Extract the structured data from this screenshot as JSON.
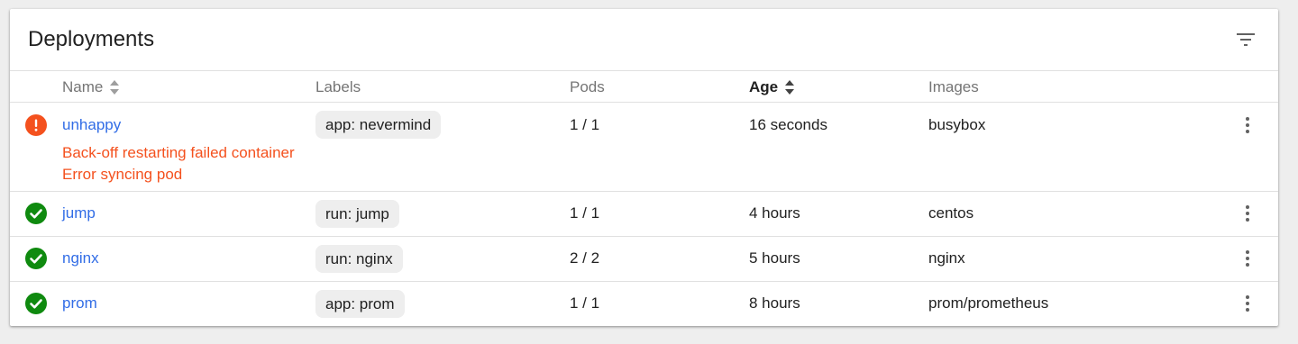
{
  "card": {
    "title": "Deployments",
    "filter_icon": "filter-list-icon"
  },
  "table": {
    "columns": [
      {
        "label": "Name",
        "sortable": true,
        "active": false
      },
      {
        "label": "Labels",
        "sortable": false,
        "active": false
      },
      {
        "label": "Pods",
        "sortable": false,
        "active": false
      },
      {
        "label": "Age",
        "sortable": true,
        "active": true
      },
      {
        "label": "Images",
        "sortable": false,
        "active": false
      }
    ],
    "rows": [
      {
        "status": "error",
        "status_icon": "error-icon",
        "name": "unhappy",
        "messages": [
          "Back-off restarting failed container",
          "Error syncing pod"
        ],
        "label": "app: nevermind",
        "pods": "1 / 1",
        "age": "16 seconds",
        "images": "busybox",
        "menu_icon": "more-vert-icon"
      },
      {
        "status": "ok",
        "status_icon": "check-circle-icon",
        "name": "jump",
        "messages": [],
        "label": "run: jump",
        "pods": "1 / 1",
        "age": "4 hours",
        "images": "centos",
        "menu_icon": "more-vert-icon"
      },
      {
        "status": "ok",
        "status_icon": "check-circle-icon",
        "name": "nginx",
        "messages": [],
        "label": "run: nginx",
        "pods": "2 / 2",
        "age": "5 hours",
        "images": "nginx",
        "menu_icon": "more-vert-icon"
      },
      {
        "status": "ok",
        "status_icon": "check-circle-icon",
        "name": "prom",
        "messages": [],
        "label": "app: prom",
        "pods": "1 / 1",
        "age": "8 hours",
        "images": "prom/prometheus",
        "menu_icon": "more-vert-icon"
      }
    ]
  },
  "colors": {
    "link": "#326de6",
    "error": "#f4511e",
    "success": "#0f8a0f",
    "chip_bg": "#eeeeee"
  }
}
